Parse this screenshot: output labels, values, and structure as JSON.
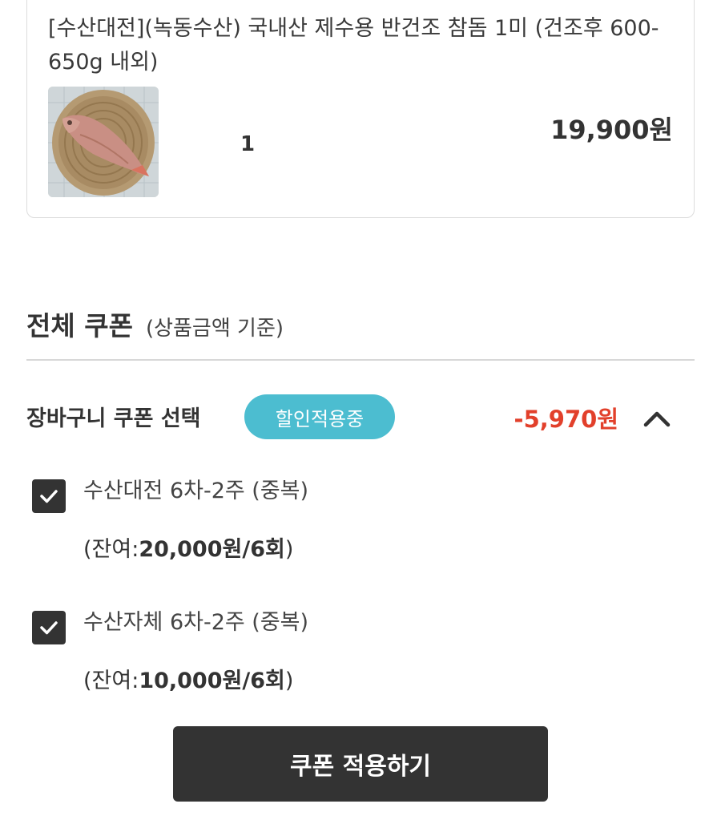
{
  "product": {
    "title": "[수산대전](녹동수산) 국내산 제수용 반건조 참돔 1미 (건조후 600-650g 내외)",
    "image_icon": "dried-red-snapper-photo",
    "quantity": "1",
    "price": "19,900원"
  },
  "coupon_section": {
    "title": "전체 쿠폰",
    "subtitle": "(상품금액 기준)"
  },
  "cart_coupon": {
    "label": "장바구니 쿠폰 선택",
    "badge": "할인적용중",
    "discount": "-5,970원",
    "expanded": true
  },
  "coupons": [
    {
      "name": "수산대전 6차-2주 (중복)",
      "remain_prefix": "(잔여:",
      "remain_value": "20,000원/6회",
      "remain_suffix": ")",
      "checked": true
    },
    {
      "name": "수산자체 6차-2주 (중복)",
      "remain_prefix": "(잔여:",
      "remain_value": "10,000원/6회",
      "remain_suffix": ")",
      "checked": true
    }
  ],
  "apply_button": "쿠폰 적용하기",
  "colors": {
    "badge": "#4cbdd0",
    "discount": "#e2402b",
    "dark": "#333333"
  }
}
